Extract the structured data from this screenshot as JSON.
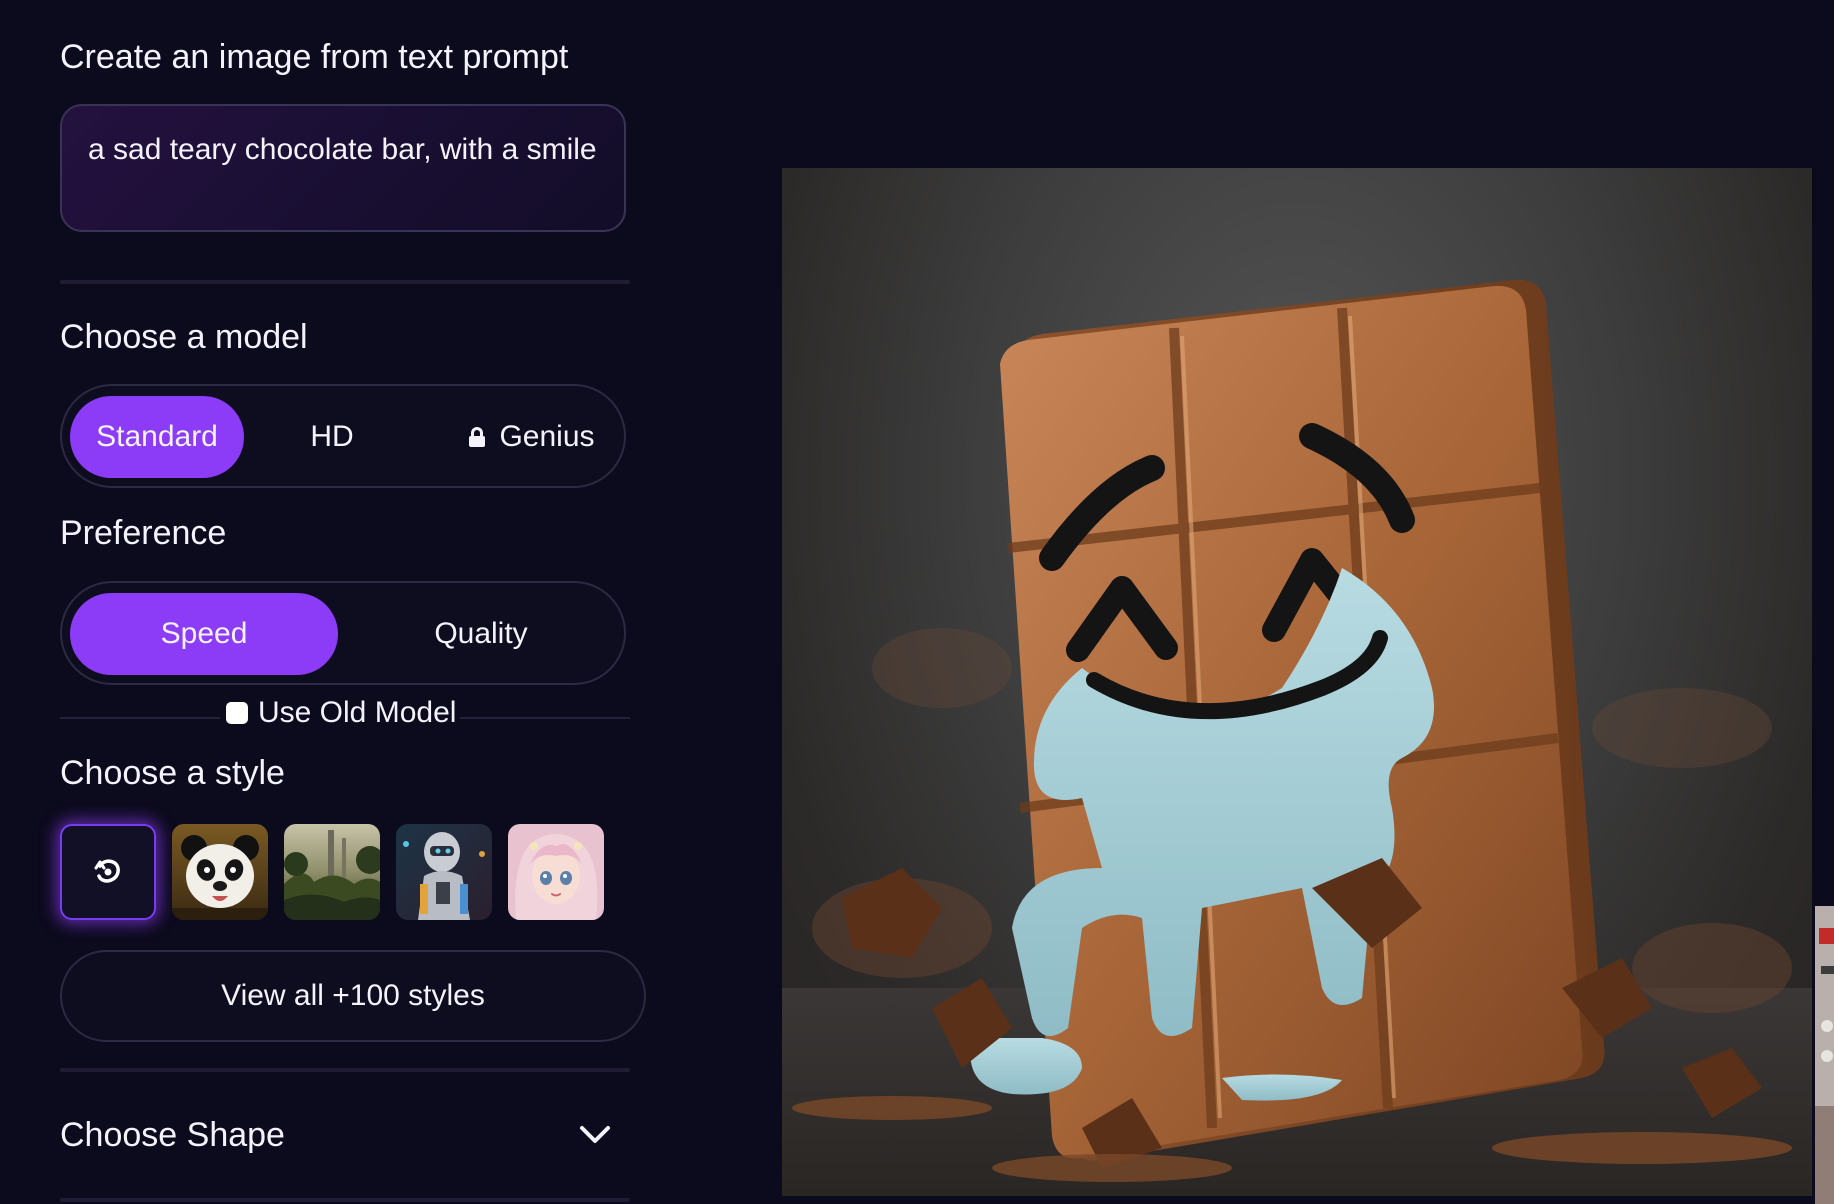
{
  "panel": {
    "prompt_heading": "Create an image from text prompt",
    "prompt_text": "a sad teary chocolate bar, with a smile",
    "model_heading": "Choose a model",
    "models": [
      {
        "label": "Standard",
        "active": true
      },
      {
        "label": "HD",
        "active": false
      },
      {
        "label": "Genius",
        "active": false,
        "locked": true
      }
    ],
    "preference_heading": "Preference",
    "preferences": [
      {
        "label": "Speed",
        "active": true
      },
      {
        "label": "Quality",
        "active": false
      }
    ],
    "old_model_label": "Use Old Model",
    "old_model_checked": false,
    "style_heading": "Choose a style",
    "styles": [
      {
        "icon": "no-style-icon",
        "selected": true
      },
      {
        "icon": "panda-style-thumbnail",
        "selected": false
      },
      {
        "icon": "landscape-style-thumbnail",
        "selected": false
      },
      {
        "icon": "robot-style-thumbnail",
        "selected": false
      },
      {
        "icon": "anime-portrait-style-thumbnail",
        "selected": false
      }
    ],
    "view_all_label": "View all +100 styles",
    "shape_heading": "Choose Shape"
  },
  "colors": {
    "background": "#0c0a1d",
    "accent": "#8c3cf6",
    "text": "#f4f2fb"
  },
  "preview": {
    "image_icon": "crying-chocolate-bar-image"
  }
}
